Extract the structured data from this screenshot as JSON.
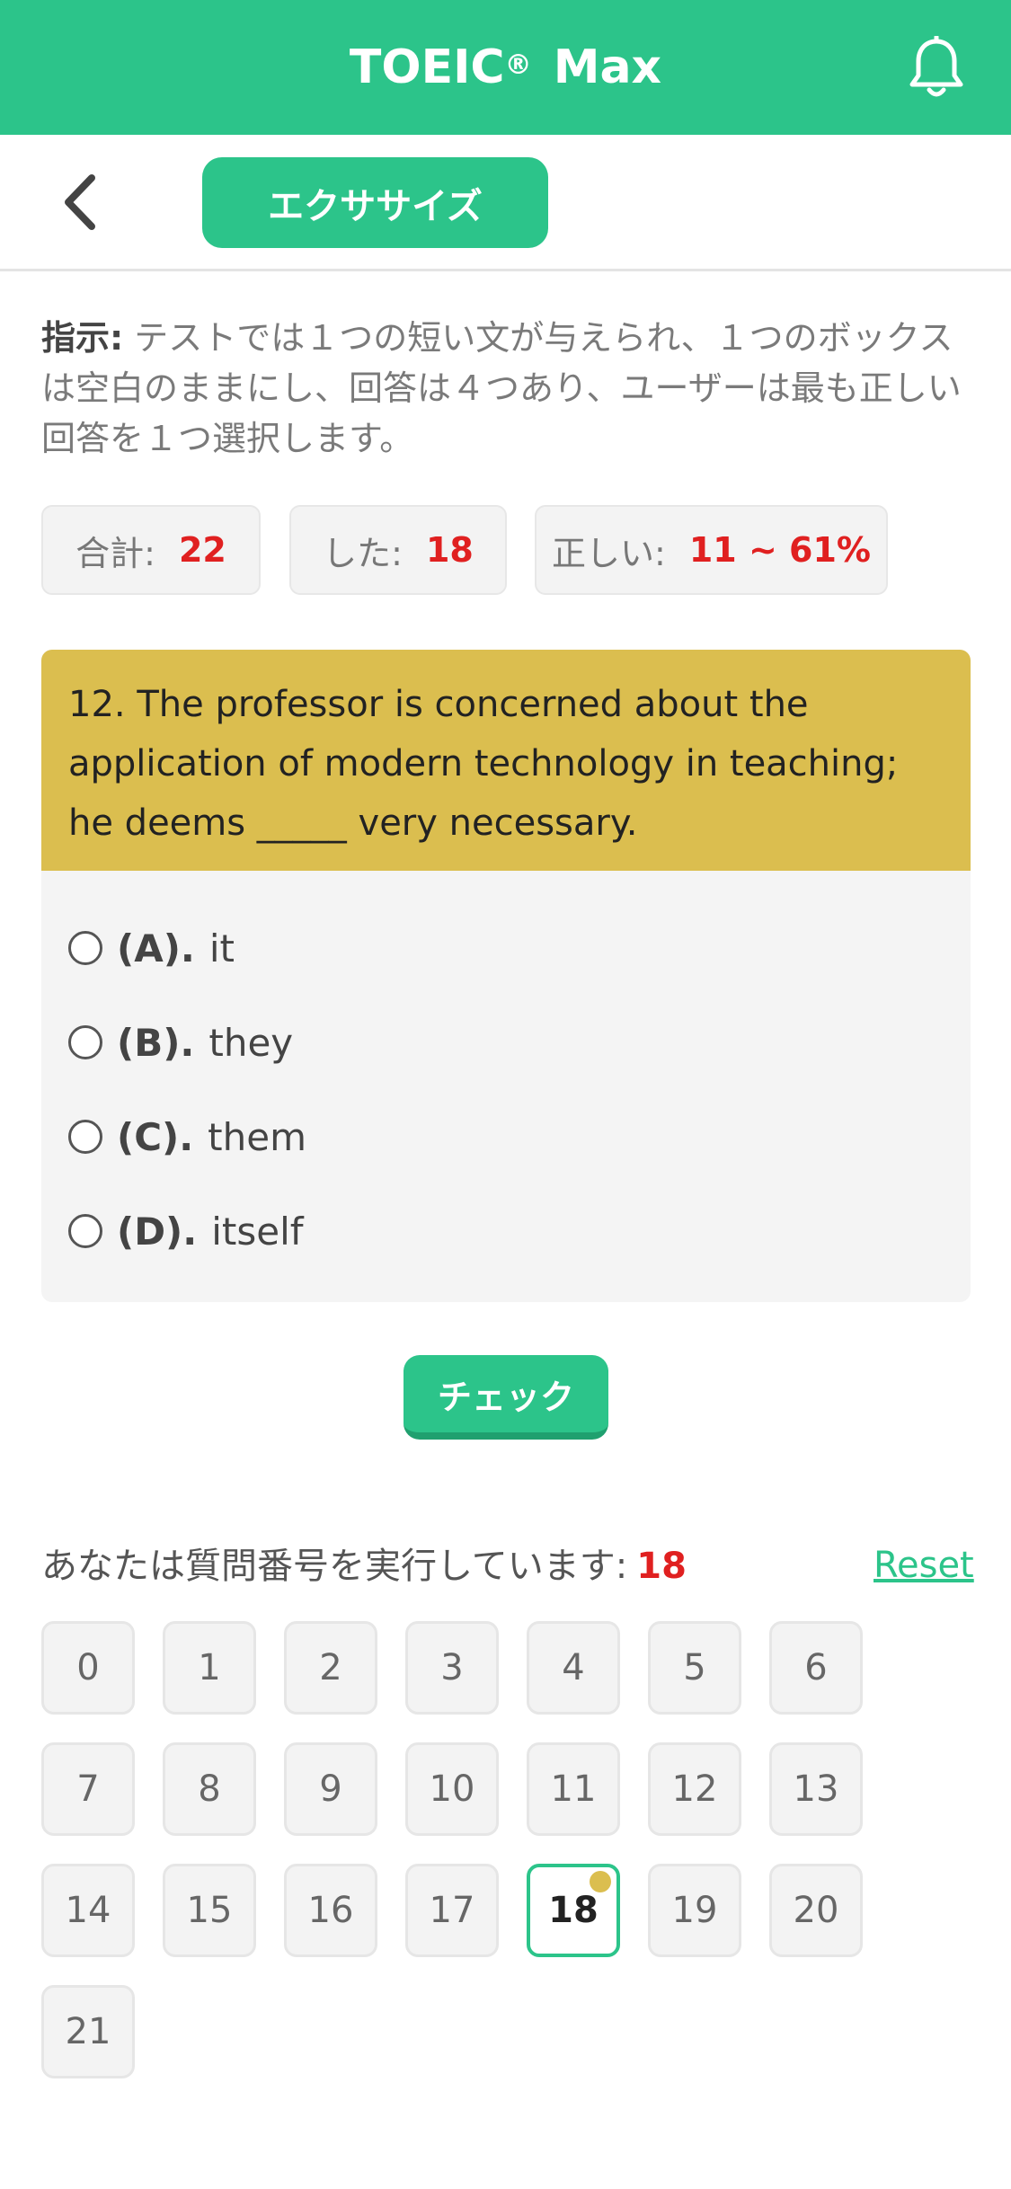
{
  "header": {
    "app_title": "TOEIC",
    "app_title_mark": "®",
    "app_title_suffix": "Max",
    "bell_icon": "bell-icon",
    "brand_color": "#2cc48a"
  },
  "subnav": {
    "back_icon": "chevron-left-icon",
    "tab_label": "エクササイズ"
  },
  "instructions": {
    "label": "指示:",
    "text": "テストでは１つの短い文が与えられ、１つのボックスは空白のままにし、回答は４つあり、ユーザーは最も正しい回答を１つ選択します。"
  },
  "stats": {
    "total_label": "合計:",
    "total_value": "22",
    "done_label": "した:",
    "done_value": "18",
    "correct_label": "正しい:",
    "correct_value": "11 ~ 61%"
  },
  "question": {
    "text": "12. The professor is concerned about the application of modern technology in teaching; he deems _____ very necessary.",
    "options": [
      {
        "letter": "(A).",
        "text": "it"
      },
      {
        "letter": "(B).",
        "text": "they"
      },
      {
        "letter": "(C).",
        "text": "them"
      },
      {
        "letter": "(D).",
        "text": "itself"
      }
    ]
  },
  "check_button": "チェック",
  "progress": {
    "label": "あなたは質問番号を実行しています:",
    "current": "18",
    "reset_label": "Reset"
  },
  "question_numbers": [
    "0",
    "1",
    "2",
    "3",
    "4",
    "5",
    "6",
    "7",
    "8",
    "9",
    "10",
    "11",
    "12",
    "13",
    "14",
    "15",
    "16",
    "17",
    "18",
    "19",
    "20",
    "21"
  ],
  "active_question": "18",
  "colors": {
    "accent": "#2cc48a",
    "question_header": "#dbbe4f",
    "highlight_number": "#e02020"
  }
}
